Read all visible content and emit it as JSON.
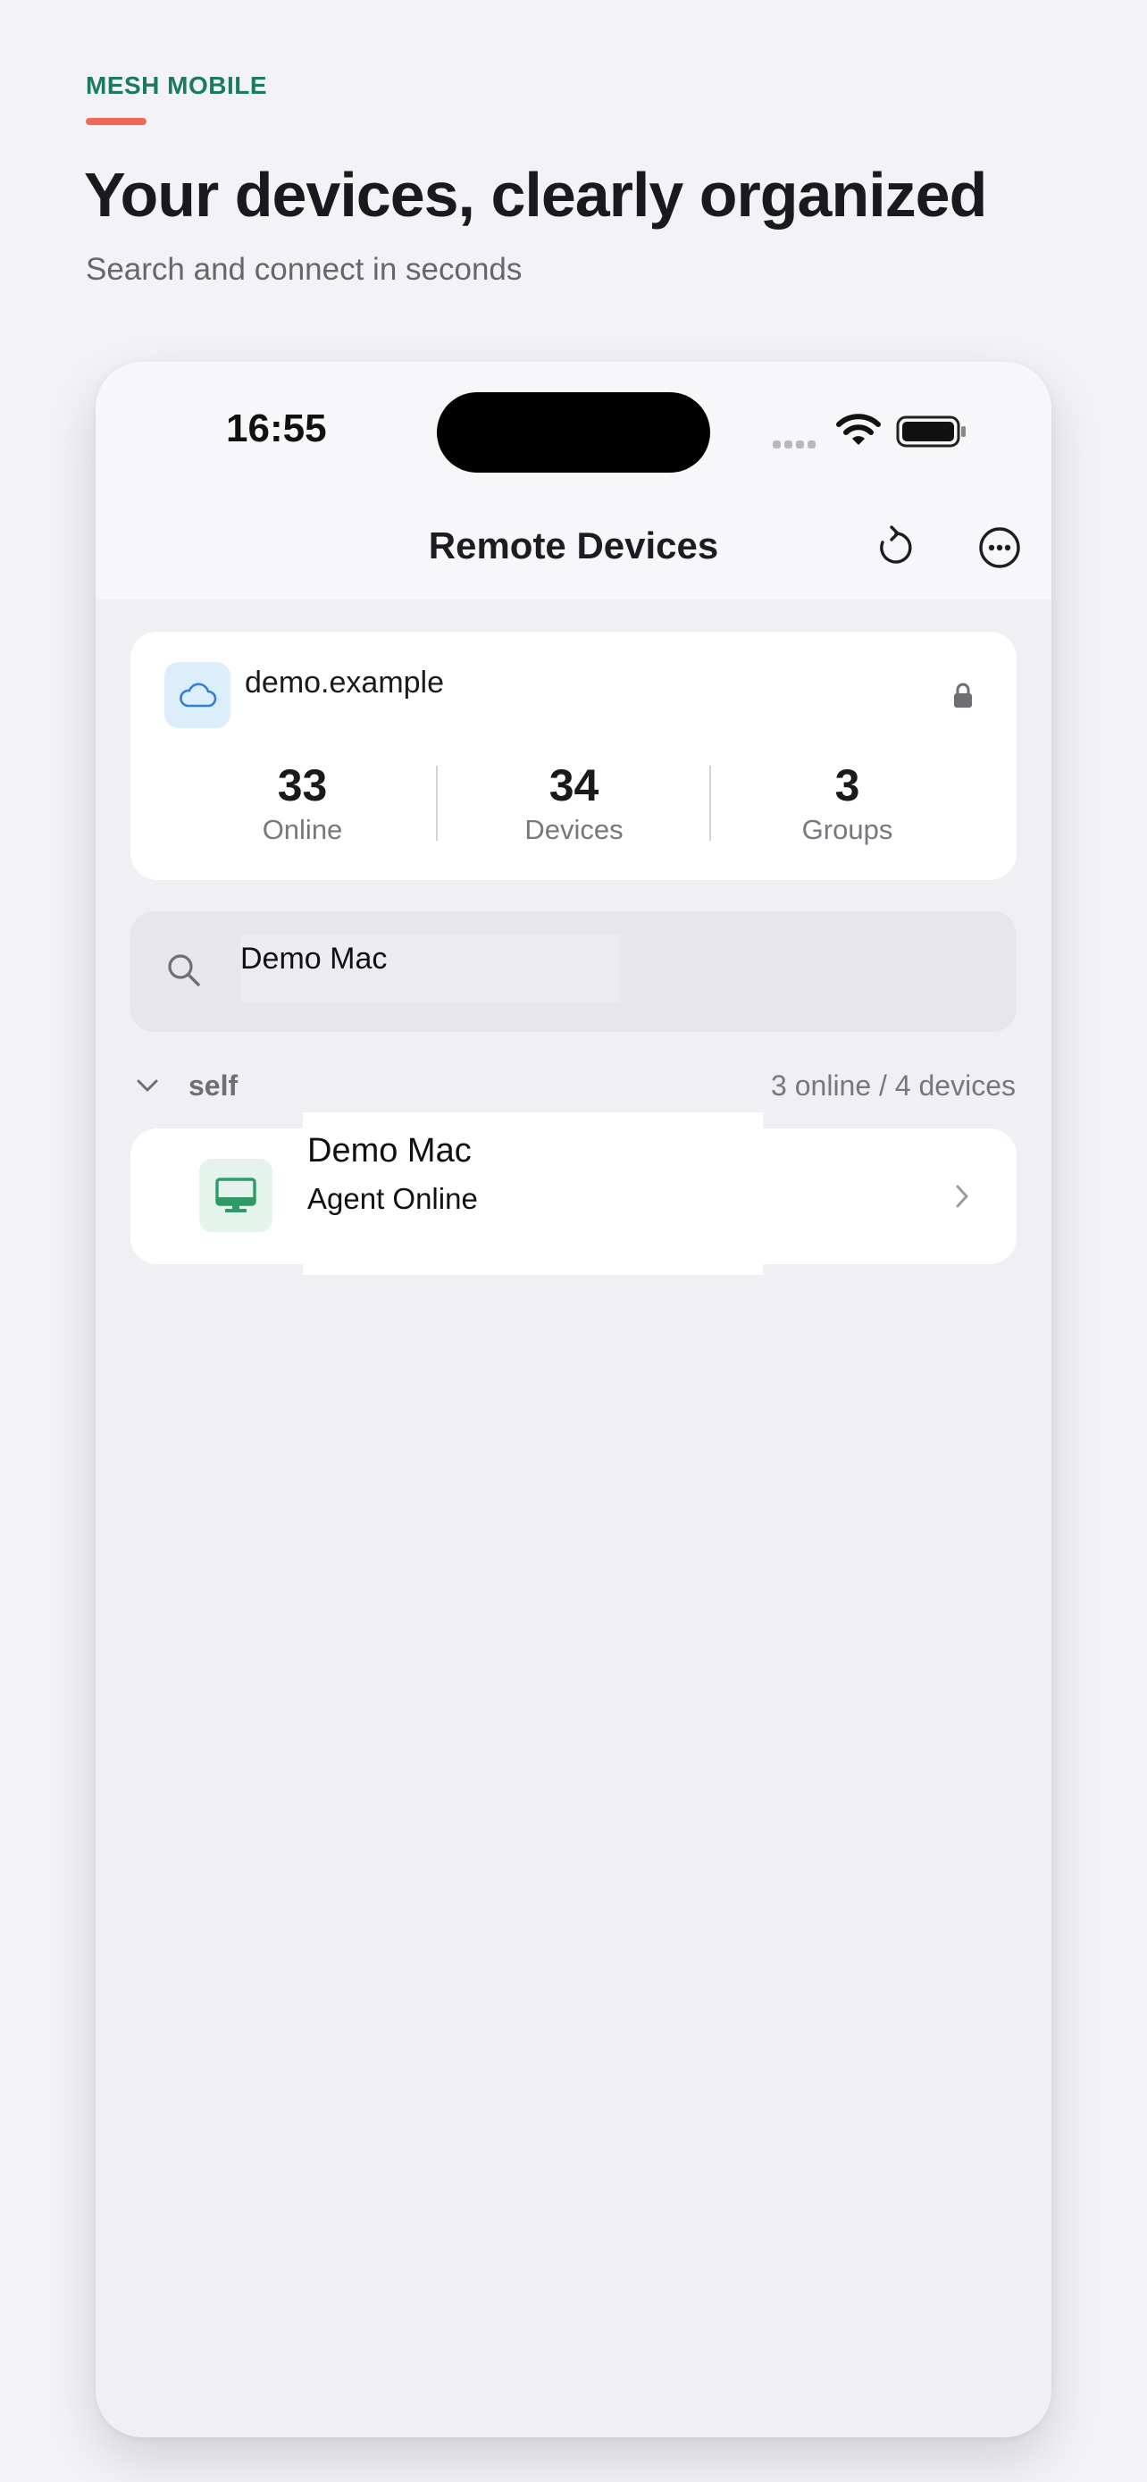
{
  "marketing": {
    "eyebrow": "MESH MOBILE",
    "headline": "Your devices, clearly organized",
    "subhead": "Search and connect in seconds"
  },
  "status_bar": {
    "time": "16:55"
  },
  "nav": {
    "title": "Remote Devices"
  },
  "server": {
    "name": "demo.example",
    "stats": [
      {
        "value": "33",
        "label": "Online"
      },
      {
        "value": "34",
        "label": "Devices"
      },
      {
        "value": "3",
        "label": "Groups"
      }
    ]
  },
  "search": {
    "value": "Demo Mac"
  },
  "group": {
    "name": "self",
    "count": "3 online / 4 devices"
  },
  "device": {
    "name": "Demo Mac",
    "status": "Agent Online"
  },
  "colors": {
    "accent_green": "#1c7a5f",
    "accent_coral": "#f06a5a",
    "cloud_blue": "#2f7fd8",
    "device_green": "#2e9a66"
  }
}
